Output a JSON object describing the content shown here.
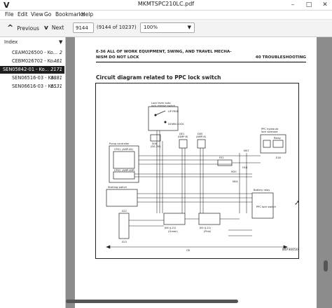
{
  "window": {
    "app_icon": "V",
    "title": "MKMTSPC210LC.pdf",
    "minimize_glyph": "–",
    "maximize_glyph": "□",
    "close_glyph": "✕"
  },
  "menu": [
    "File",
    "Edit",
    "View",
    "Go",
    "Bookmarks",
    "Help"
  ],
  "toolbar": {
    "previous_label": "Previous",
    "next_label": "Next",
    "page_value": "9144",
    "page_count": "(9144 of 10237)",
    "zoom_value": "100%"
  },
  "sidebar": {
    "header": "Index",
    "items": [
      {
        "name": "CEAM026500 - Ko...",
        "page": "2",
        "selected": false
      },
      {
        "name": "CEBM026702 - Ko...",
        "page": "461",
        "selected": false
      },
      {
        "name": "SEN05842-01 - Ko...",
        "page": "2171",
        "selected": true
      },
      {
        "name": "SEN06516-03 - Ko...",
        "page": "3881",
        "selected": false
      },
      {
        "name": "SEN06616-03 - Ko...",
        "page": "6531",
        "selected": false
      }
    ]
  },
  "document": {
    "header_left_1": "E-36 ALL OF WORK EQUIPMENT, SWING, AND TRAVEL MECHA-",
    "header_left_2": "NISM DO NOT LOCK",
    "header_right": "40 TROUBLESHOOTING",
    "section_title": "Circuit diagram related to PPC lock switch",
    "labels": {
      "lock_lever": "Lock lever auto",
      "lock_lever_2": "lock release switch",
      "up_free": "UP FREE",
      "down_lock": "DOWN LOCK",
      "s06": "S06",
      "s06_2": "(DS-2M)",
      "pump_controller": "Pump controller",
      "cp01": "CP01",
      "cp01_2": "(AMP-81)",
      "cp02": "CP02",
      "cp02_2": "(AMP-40P)",
      "de1": "DE1",
      "de1_2": "(DMP-6)",
      "d05": "D05",
      "d05_2": "(AMP-6)",
      "ppc_hydraulic": "PPC hydraulic",
      "lock_solenoid": "lock solenoid",
      "relay_h01": "Relay",
      "fe1": "FE1",
      "m47": "M47",
      "m20": "M20",
      "h18": "H18",
      "e16": "E16",
      "main_fuse": "Battery relay",
      "m04": "M04",
      "starting_switch": "Starting switch",
      "s22": "S22",
      "s23": "S23",
      "jo6": "J06 (J-21)",
      "jo5": "J05 (J-21)",
      "grn": "(Green)",
      "pink": "(Pink)",
      "lock_sw": "PPC lock switch",
      "cb": "CB",
      "diagram_code": "84P30050"
    }
  },
  "colors": {
    "selected_bg": "#1e1e1e",
    "viewer_bg": "#8c8c8c"
  },
  "icons": {
    "prev": "chevron-up-icon",
    "next": "chevron-down-icon",
    "zoom_dropdown": "caret-down-icon",
    "sidebar_dropdown": "caret-down-icon",
    "cursor": "mouse-pointer-icon"
  }
}
